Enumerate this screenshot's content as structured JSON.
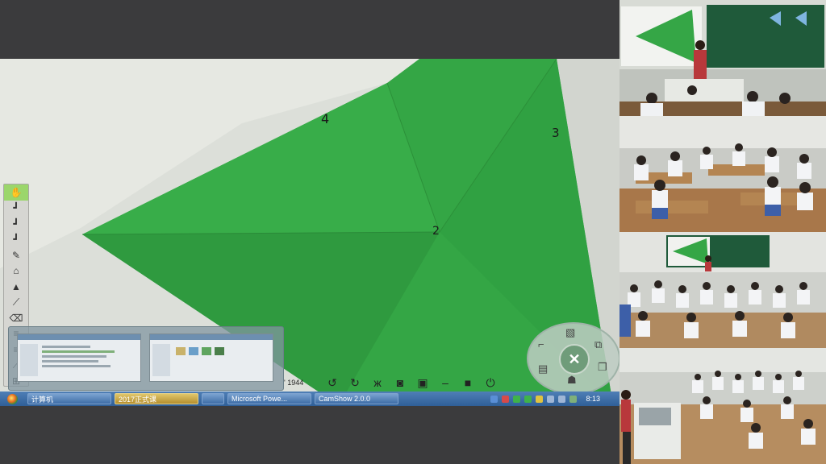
{
  "canvas": {
    "marks": [
      "4",
      "3",
      "2"
    ]
  },
  "toolbar": {
    "tools": [
      {
        "name": "hand-icon",
        "glyph": "✋"
      },
      {
        "name": "pen-icon",
        "glyph": "┛"
      },
      {
        "name": "pen-icon",
        "glyph": "┛"
      },
      {
        "name": "pen-icon",
        "glyph": "┛"
      },
      {
        "name": "pencil-icon",
        "glyph": "✎"
      },
      {
        "name": "shapes-icon",
        "glyph": "⌂"
      },
      {
        "name": "stamp-icon",
        "glyph": "▲"
      },
      {
        "name": "brush-icon",
        "glyph": "⟋"
      },
      {
        "name": "trash-icon",
        "glyph": "🗑"
      },
      {
        "name": "lines-icon",
        "glyph": "≡"
      },
      {
        "name": "lines-icon",
        "glyph": "≡"
      },
      {
        "name": "eyedropper-icon",
        "glyph": "⟋"
      },
      {
        "name": "grid-icon",
        "glyph": "⊞"
      }
    ]
  },
  "cam_bar": {
    "value": "' 1944",
    "icons": [
      "undo-icon",
      "redo-icon",
      "butterfly-icon",
      "camera-icon",
      "record-icon",
      "minimize-icon",
      "maximize-icon",
      "power-icon"
    ]
  },
  "taskbar": {
    "items": [
      {
        "label": "计算机",
        "active": false
      },
      {
        "label": "2017正式课",
        "active": true
      },
      {
        "label": "",
        "active": false
      },
      {
        "label": "Microsoft Powe...",
        "active": false
      },
      {
        "label": "CamShow 2.0.0",
        "active": false
      }
    ],
    "clock": "8:13"
  },
  "colors": {
    "paper_green": "#34a645",
    "background_gray": "#3b3b3d",
    "taskbar_blue": "#3f6ea7"
  }
}
